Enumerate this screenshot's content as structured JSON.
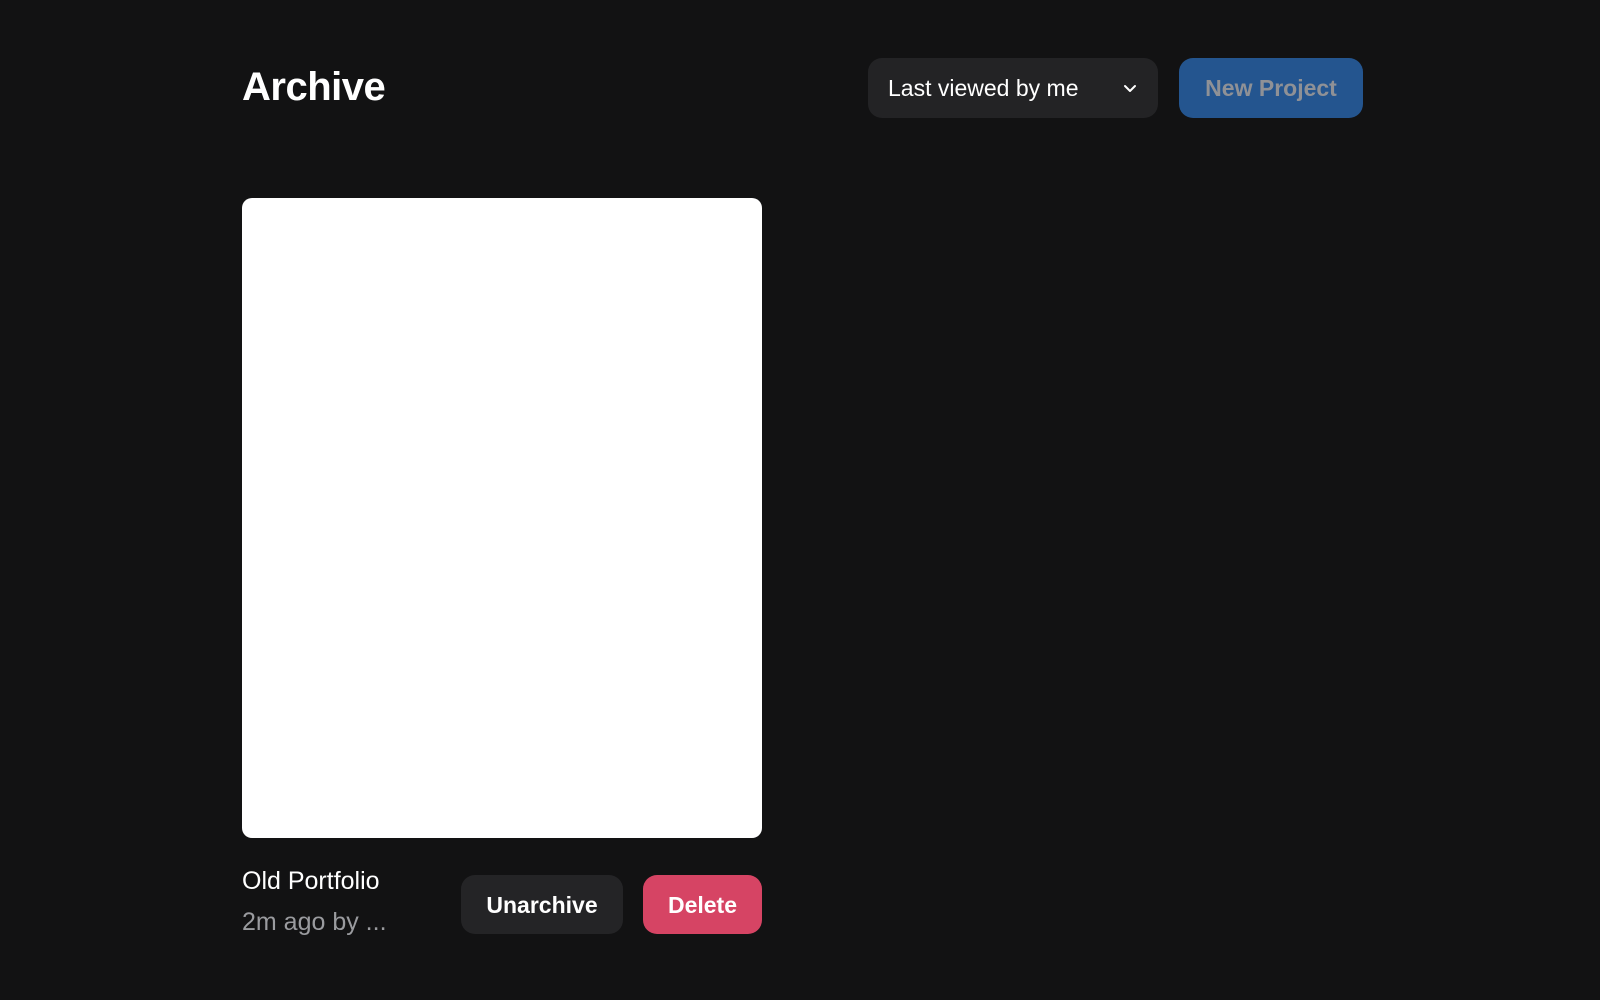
{
  "header": {
    "title": "Archive",
    "sort": {
      "selected": "Last viewed by me",
      "icon": "chevron-down-icon"
    },
    "new_project_label": "New Project"
  },
  "projects": [
    {
      "name": "Old Portfolio",
      "meta": "2m ago by ...",
      "actions": {
        "unarchive_label": "Unarchive",
        "delete_label": "Delete"
      }
    }
  ],
  "colors": {
    "background": "#121213",
    "surface": "#232325",
    "primary_button": "#24558f",
    "primary_button_text": "#8f9196",
    "danger_button": "#d64464",
    "muted_text": "#9a9b9f",
    "thumbnail": "#ffffff"
  }
}
